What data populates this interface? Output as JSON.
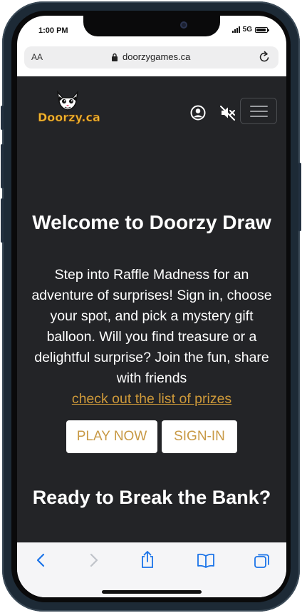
{
  "status": {
    "time": "1:00 PM",
    "network": "5G",
    "battery_level": 0.9
  },
  "browser": {
    "aa_label": "AA",
    "url": "doorzygames.ca"
  },
  "site": {
    "logo_text": "Doorzy.ca",
    "heading": "Welcome to Doorzy Draw",
    "intro": "Step into Raffle Madness for an adventure of surprises! Sign in, choose your spot, and pick a mystery gift balloon. Will you find treasure or a delightful surprise? Join the fun, share with friends",
    "prizes_link": "check out the list of prizes",
    "play_button": "PLAY NOW",
    "signin_button": "SIGN-IN",
    "subheading": "Ready to Break the Bank?"
  },
  "colors": {
    "page_bg": "#232427",
    "accent": "#cf9a3a",
    "ios_blue": "#1a73e8"
  }
}
